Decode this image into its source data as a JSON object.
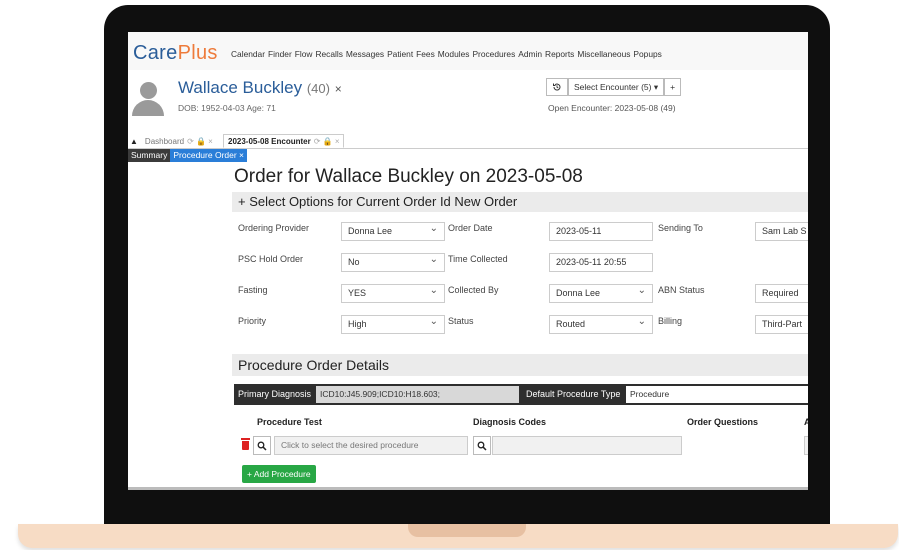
{
  "app": {
    "logo_part1": "Care",
    "logo_part2": "Plus"
  },
  "menu": [
    "Calendar",
    "Finder",
    "Flow",
    "Recalls",
    "Messages",
    "Patient",
    "Fees",
    "Modules",
    "Procedures",
    "Admin",
    "Reports",
    "Miscellaneous",
    "Popups"
  ],
  "patient": {
    "name": "Wallace Buckley",
    "age": "(40)",
    "close": "×",
    "dob_line": "DOB: 1952-04-03 Age: 71"
  },
  "encounter": {
    "history_icon": "history-icon",
    "select_label": "Select Encounter (5) ▾",
    "add_label": "+",
    "open_line": "Open Encounter: 2023-05-08 (49)"
  },
  "tabs": {
    "toggle": "▲",
    "dashboard": "Dashboard",
    "encounter": "2023-05-08 Encounter",
    "icons": "⟳ 🔒 ×"
  },
  "subtabs": {
    "summary": "Summary",
    "procedure_order": "Procedure Order ×"
  },
  "order": {
    "title": "Order for Wallace Buckley on 2023-05-08",
    "options_head": "+ Select Options for Current Order Id New Order",
    "ordering_provider_label": "Ordering Provider",
    "ordering_provider_value": "Donna Lee",
    "order_date_label": "Order Date",
    "order_date_value": "2023-05-11",
    "sending_to_label": "Sending To",
    "sending_to_value": "Sam Lab S",
    "psc_hold_label": "PSC Hold Order",
    "psc_hold_value": "No",
    "time_collected_label": "Time Collected",
    "time_collected_value": "2023-05-11 20:55",
    "fasting_label": "Fasting",
    "fasting_value": "YES",
    "collected_by_label": "Collected By",
    "collected_by_value": "Donna Lee",
    "abn_status_label": "ABN Status",
    "abn_status_value": "Required",
    "priority_label": "Priority",
    "priority_value": "High",
    "status_label": "Status",
    "status_value": "Routed",
    "billing_label": "Billing",
    "billing_value": "Third-Part"
  },
  "details": {
    "head": "Procedure Order Details",
    "primary_diagnosis_label": "Primary Diagnosis",
    "primary_diagnosis_value": "ICD10:J45.909;ICD10:H18.603;",
    "default_type_label": "Default Procedure Type",
    "default_type_value": "Procedure",
    "col_procedure_test": "Procedure Test",
    "col_diagnosis_codes": "Diagnosis Codes",
    "col_order_questions": "Order Questions",
    "col_trailing": "A",
    "procedure_placeholder": "Click to select the desired procedure",
    "add_procedure": "+ Add Procedure"
  },
  "colors": {
    "brand_blue": "#2a5d99",
    "brand_orange": "#ee7b3b",
    "active_tab": "#2a7ed8",
    "add_green": "#28a745"
  }
}
